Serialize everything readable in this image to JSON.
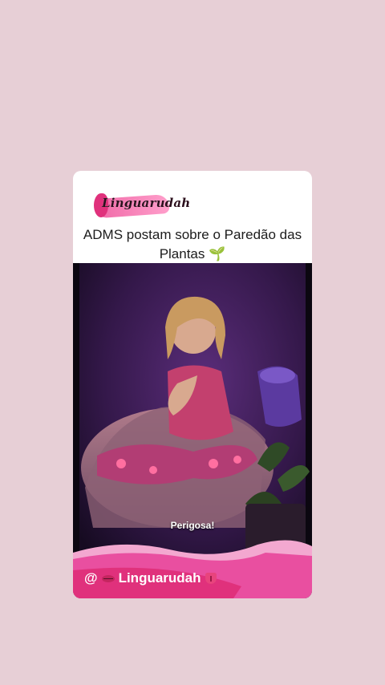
{
  "post": {
    "brand_logo_text": "Linguarudah",
    "headline": "ADMS postam sobre o Paredão das Plantas",
    "headline_emoji": "🌱",
    "subtitle": "Perigosa!",
    "handle_prefix": "@",
    "handle_name": "Linguarudah"
  },
  "colors": {
    "background": "#e7cfd6",
    "card": "#ffffff",
    "brand_pink": "#e0317c",
    "video_purple": "#3a1d4f"
  },
  "icons": [
    "sprout-icon",
    "lips-icon",
    "tongue-icon"
  ]
}
